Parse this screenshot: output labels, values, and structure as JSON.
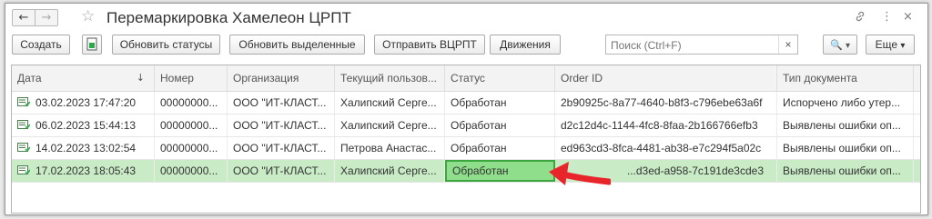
{
  "window": {
    "title": "Перемаркировка Хамелеон ЦРПТ",
    "nav_back": "←",
    "nav_forward": "→",
    "star": "☆",
    "link_icon": "🔗",
    "more_icon": "⋮",
    "close_icon": "×"
  },
  "toolbar": {
    "create": "Создать",
    "refresh_statuses": "Обновить статусы",
    "refresh_selected": "Обновить выделенные",
    "send_vcrpt": "Отправить ВЦРПТ",
    "movements": "Движения",
    "search_placeholder": "Поиск (Ctrl+F)",
    "search_clear": "×",
    "search_button": "🔍",
    "search_dropdown": "▾",
    "more": "Еще",
    "more_dropdown": "▾"
  },
  "table": {
    "columns": [
      "Дата",
      "Номер",
      "Организация",
      "Текущий пользов...",
      "Статус",
      "Order ID",
      "Тип документа"
    ],
    "sort_indicator": "↓",
    "rows": [
      {
        "date": "03.02.2023 17:47:20",
        "number": "00000000...",
        "org": "ООО \"ИТ-КЛАСТ...",
        "user": "Халипский Серге...",
        "status": "Обработан",
        "order_id": "2b90925c-8a77-4640-b8f3-c796ebe63a6f",
        "doc_type": "Испорчено либо утер..."
      },
      {
        "date": "06.02.2023 15:44:13",
        "number": "00000000...",
        "org": "ООО \"ИТ-КЛАСТ...",
        "user": "Халипский Серге...",
        "status": "Обработан",
        "order_id": "d2c12d4c-1144-4fc8-8faa-2b166766efb3",
        "doc_type": "Выявлены ошибки оп..."
      },
      {
        "date": "14.02.2023 13:02:54",
        "number": "00000000...",
        "org": "ООО \"ИТ-КЛАСТ...",
        "user": "Петрова Анастас...",
        "status": "Обработан",
        "order_id": "ed963cd3-8fca-4481-ab38-e7c294f5a02c",
        "doc_type": "Выявлены ошибки оп..."
      },
      {
        "date": "17.02.2023 18:05:43",
        "number": "00000000...",
        "org": "ООО \"ИТ-КЛАСТ...",
        "user": "Халипский Серге...",
        "status": "Обработан",
        "order_id": "...d3ed-a958-7c191de3cde3",
        "doc_type": "Выявлены ошибки оп..."
      }
    ]
  },
  "colors": {
    "selected_row": "#c9ecc6",
    "status_highlight": "#8fde8b",
    "arrow": "#e8252a"
  }
}
